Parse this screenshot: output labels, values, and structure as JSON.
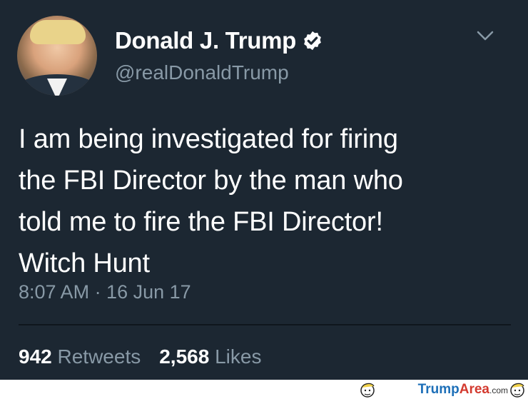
{
  "tweet": {
    "display_name": "Donald J. Trump",
    "handle": "@realDonaldTrump",
    "text_lines": [
      "I am being investigated for firing",
      "the FBI Director by the man who",
      "told me to fire the FBI Director!",
      "Witch Hunt"
    ],
    "timestamp": "8:07 AM · 16 Jun 17",
    "retweets_count": "942",
    "retweets_label": "Retweets",
    "likes_count": "2,568",
    "likes_label": "Likes"
  },
  "watermark": {
    "part1": "Trump",
    "part2": "Area",
    "part3": ".com"
  },
  "colors": {
    "background": "#1c2732",
    "secondary_text": "#8899a6",
    "verified_badge": "#ffffff"
  },
  "icons": {
    "verified": "verified-badge-icon",
    "menu": "chevron-down-icon"
  }
}
